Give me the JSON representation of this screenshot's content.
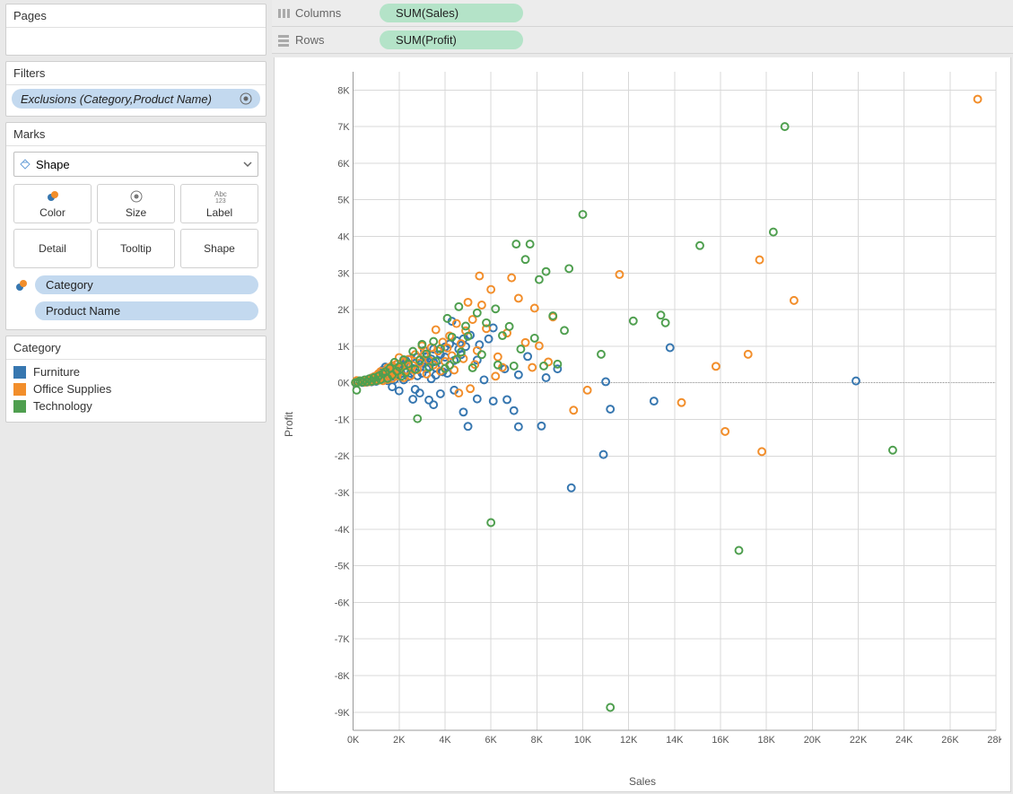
{
  "panels": {
    "pages_title": "Pages",
    "filters_title": "Filters",
    "marks_title": "Marks",
    "legend_title": "Category"
  },
  "filters": {
    "pill_label": "Exclusions (Category,Product Name)"
  },
  "marks": {
    "type_label": "Shape",
    "buttons": {
      "color": "Color",
      "size": "Size",
      "label": "Label",
      "detail": "Detail",
      "tooltip": "Tooltip",
      "shape": "Shape"
    },
    "shelves": [
      "Category",
      "Product Name"
    ]
  },
  "legend": {
    "items": [
      {
        "label": "Furniture",
        "color": "#3777b0"
      },
      {
        "label": "Office Supplies",
        "color": "#f28e2b"
      },
      {
        "label": "Technology",
        "color": "#4f9f4f"
      }
    ]
  },
  "shelves": {
    "columns_label": "Columns",
    "rows_label": "Rows",
    "columns_field": "SUM(Sales)",
    "rows_field": "SUM(Profit)"
  },
  "chart_data": {
    "type": "scatter",
    "xlabel": "Sales",
    "ylabel": "Profit",
    "xlim": [
      0,
      28000
    ],
    "ylim": [
      -9500,
      8500
    ],
    "x_ticks": [
      0,
      2000,
      4000,
      6000,
      8000,
      10000,
      12000,
      14000,
      16000,
      18000,
      20000,
      22000,
      24000,
      26000,
      28000
    ],
    "x_tick_labels": [
      "0K",
      "2K",
      "4K",
      "6K",
      "8K",
      "10K",
      "12K",
      "14K",
      "16K",
      "18K",
      "20K",
      "22K",
      "24K",
      "26K",
      "28K"
    ],
    "y_ticks": [
      -9000,
      -8000,
      -7000,
      -6000,
      -5000,
      -4000,
      -3000,
      -2000,
      -1000,
      0,
      1000,
      2000,
      3000,
      4000,
      5000,
      6000,
      7000,
      8000
    ],
    "y_tick_labels": [
      "-9K",
      "-8K",
      "-7K",
      "-6K",
      "-5K",
      "-4K",
      "-3K",
      "-2K",
      "-1K",
      "0K",
      "1K",
      "2K",
      "3K",
      "4K",
      "5K",
      "6K",
      "7K",
      "8K"
    ],
    "series": [
      {
        "name": "Furniture",
        "color": "#3777b0",
        "points": [
          [
            21900,
            50
          ],
          [
            13800,
            960
          ],
          [
            13100,
            -500
          ],
          [
            11200,
            -720
          ],
          [
            11000,
            30
          ],
          [
            10900,
            -1960
          ],
          [
            9500,
            -2870
          ],
          [
            8900,
            380
          ],
          [
            8400,
            140
          ],
          [
            8200,
            -1180
          ],
          [
            7600,
            720
          ],
          [
            7200,
            -1200
          ],
          [
            7200,
            220
          ],
          [
            7000,
            -760
          ],
          [
            6700,
            -460
          ],
          [
            6600,
            380
          ],
          [
            6100,
            -500
          ],
          [
            6100,
            1500
          ],
          [
            5900,
            1200
          ],
          [
            5700,
            80
          ],
          [
            5500,
            1040
          ],
          [
            5400,
            -440
          ],
          [
            5400,
            620
          ],
          [
            5100,
            1300
          ],
          [
            5000,
            -1190
          ],
          [
            4900,
            990
          ],
          [
            4800,
            1200
          ],
          [
            4800,
            -800
          ],
          [
            4700,
            770
          ],
          [
            4600,
            920
          ],
          [
            4500,
            1150
          ],
          [
            4400,
            -200
          ],
          [
            4400,
            610
          ],
          [
            4300,
            1680
          ],
          [
            4200,
            1060
          ],
          [
            4100,
            260
          ],
          [
            4000,
            700
          ],
          [
            4000,
            980
          ],
          [
            3900,
            300
          ],
          [
            3800,
            -300
          ],
          [
            3800,
            770
          ],
          [
            3700,
            610
          ],
          [
            3600,
            410
          ],
          [
            3600,
            210
          ],
          [
            3500,
            -600
          ],
          [
            3500,
            920
          ],
          [
            3500,
            570
          ],
          [
            3400,
            650
          ],
          [
            3400,
            110
          ],
          [
            3300,
            -470
          ],
          [
            3300,
            440
          ],
          [
            3200,
            720
          ],
          [
            3200,
            380
          ],
          [
            3100,
            880
          ],
          [
            3100,
            620
          ],
          [
            3000,
            260
          ],
          [
            3000,
            540
          ],
          [
            2900,
            -280
          ],
          [
            2900,
            420
          ],
          [
            2800,
            700
          ],
          [
            2800,
            190
          ],
          [
            2700,
            -180
          ],
          [
            2700,
            530
          ],
          [
            2600,
            390
          ],
          [
            2600,
            -450
          ],
          [
            2500,
            650
          ],
          [
            2500,
            260
          ],
          [
            2400,
            490
          ],
          [
            2400,
            170
          ],
          [
            2300,
            600
          ],
          [
            2300,
            310
          ],
          [
            2200,
            80
          ],
          [
            2200,
            460
          ],
          [
            2100,
            530
          ],
          [
            2100,
            250
          ],
          [
            2000,
            -220
          ],
          [
            2000,
            380
          ],
          [
            1900,
            500
          ],
          [
            1900,
            230
          ],
          [
            1800,
            340
          ],
          [
            1800,
            90
          ],
          [
            1700,
            450
          ],
          [
            1700,
            180
          ],
          [
            1700,
            -110
          ],
          [
            1600,
            380
          ],
          [
            1600,
            160
          ],
          [
            1500,
            60
          ],
          [
            1500,
            310
          ],
          [
            1400,
            240
          ],
          [
            1400,
            430
          ],
          [
            1300,
            170
          ],
          [
            1300,
            350
          ],
          [
            1200,
            100
          ],
          [
            1200,
            280
          ],
          [
            1100,
            70
          ],
          [
            1100,
            230
          ],
          [
            1000,
            40
          ],
          [
            1000,
            190
          ],
          [
            900,
            160
          ],
          [
            900,
            60
          ],
          [
            800,
            130
          ],
          [
            800,
            25
          ],
          [
            700,
            100
          ],
          [
            700,
            40
          ],
          [
            600,
            80
          ],
          [
            600,
            20
          ],
          [
            500,
            60
          ],
          [
            500,
            15
          ],
          [
            400,
            45
          ],
          [
            400,
            10
          ],
          [
            300,
            25
          ],
          [
            200,
            15
          ],
          [
            200,
            55
          ],
          [
            100,
            8
          ]
        ]
      },
      {
        "name": "Office Supplies",
        "color": "#f28e2b",
        "points": [
          [
            27200,
            7750
          ],
          [
            19200,
            2250
          ],
          [
            17200,
            780
          ],
          [
            17700,
            3360
          ],
          [
            17800,
            -1880
          ],
          [
            16200,
            -1330
          ],
          [
            14300,
            -540
          ],
          [
            15800,
            450
          ],
          [
            11600,
            2960
          ],
          [
            10200,
            -200
          ],
          [
            9600,
            -750
          ],
          [
            8700,
            1800
          ],
          [
            8500,
            570
          ],
          [
            8100,
            1010
          ],
          [
            7900,
            2040
          ],
          [
            7800,
            420
          ],
          [
            7500,
            1100
          ],
          [
            7200,
            2310
          ],
          [
            6900,
            2870
          ],
          [
            6700,
            1360
          ],
          [
            6500,
            420
          ],
          [
            6300,
            710
          ],
          [
            6200,
            180
          ],
          [
            6000,
            2550
          ],
          [
            5800,
            1480
          ],
          [
            5600,
            2125
          ],
          [
            5500,
            2920
          ],
          [
            5400,
            880
          ],
          [
            5300,
            500
          ],
          [
            5200,
            1730
          ],
          [
            5100,
            -160
          ],
          [
            5000,
            2200
          ],
          [
            4900,
            1420
          ],
          [
            4800,
            660
          ],
          [
            4700,
            1070
          ],
          [
            4600,
            -280
          ],
          [
            4500,
            1620
          ],
          [
            4400,
            350
          ],
          [
            4300,
            740
          ],
          [
            4200,
            1280
          ],
          [
            4100,
            950
          ],
          [
            4000,
            580
          ],
          [
            3900,
            1110
          ],
          [
            3800,
            320
          ],
          [
            3700,
            870
          ],
          [
            3600,
            1450
          ],
          [
            3500,
            490
          ],
          [
            3400,
            960
          ],
          [
            3300,
            620
          ],
          [
            3200,
            240
          ],
          [
            3100,
            780
          ],
          [
            3000,
            1010
          ],
          [
            2900,
            540
          ],
          [
            2800,
            360
          ],
          [
            2700,
            770
          ],
          [
            2600,
            470
          ],
          [
            2500,
            190
          ],
          [
            2400,
            640
          ],
          [
            2300,
            350
          ],
          [
            2200,
            570
          ],
          [
            2200,
            140
          ],
          [
            2100,
            440
          ],
          [
            2000,
            290
          ],
          [
            2000,
            690
          ],
          [
            1900,
            510
          ],
          [
            1900,
            180
          ],
          [
            1800,
            390
          ],
          [
            1800,
            260
          ],
          [
            1700,
            470
          ],
          [
            1700,
            120
          ],
          [
            1600,
            340
          ],
          [
            1600,
            230
          ],
          [
            1500,
            410
          ],
          [
            1500,
            90
          ],
          [
            1400,
            280
          ],
          [
            1400,
            180
          ],
          [
            1300,
            60
          ],
          [
            1300,
            230
          ],
          [
            1200,
            310
          ],
          [
            1200,
            140
          ],
          [
            1100,
            250
          ],
          [
            1100,
            70
          ],
          [
            1000,
            190
          ],
          [
            1000,
            100
          ],
          [
            900,
            160
          ],
          [
            900,
            60
          ],
          [
            800,
            130
          ],
          [
            800,
            40
          ],
          [
            700,
            100
          ],
          [
            700,
            30
          ],
          [
            600,
            75
          ],
          [
            600,
            25
          ],
          [
            500,
            55
          ],
          [
            500,
            15
          ],
          [
            400,
            40
          ],
          [
            300,
            25
          ],
          [
            200,
            15
          ],
          [
            150,
            60
          ],
          [
            100,
            8
          ]
        ]
      },
      {
        "name": "Technology",
        "color": "#4f9f4f",
        "points": [
          [
            18800,
            7000
          ],
          [
            18300,
            4120
          ],
          [
            15100,
            3750
          ],
          [
            16800,
            -4580
          ],
          [
            23500,
            -1840
          ],
          [
            13600,
            1640
          ],
          [
            13400,
            1850
          ],
          [
            12200,
            1690
          ],
          [
            11200,
            -8870
          ],
          [
            10800,
            780
          ],
          [
            10000,
            4600
          ],
          [
            9400,
            3120
          ],
          [
            9200,
            1430
          ],
          [
            8900,
            510
          ],
          [
            8700,
            1830
          ],
          [
            8400,
            3040
          ],
          [
            8300,
            460
          ],
          [
            8100,
            2820
          ],
          [
            7900,
            1220
          ],
          [
            7700,
            3790
          ],
          [
            7500,
            3370
          ],
          [
            7300,
            920
          ],
          [
            7100,
            3790
          ],
          [
            7000,
            460
          ],
          [
            6800,
            1540
          ],
          [
            6500,
            1290
          ],
          [
            6300,
            490
          ],
          [
            6200,
            2020
          ],
          [
            6000,
            -3820
          ],
          [
            5800,
            1640
          ],
          [
            5600,
            770
          ],
          [
            5400,
            1910
          ],
          [
            5200,
            410
          ],
          [
            5000,
            1270
          ],
          [
            4900,
            1550
          ],
          [
            4700,
            840
          ],
          [
            4600,
            2080
          ],
          [
            4500,
            640
          ],
          [
            4300,
            1250
          ],
          [
            4200,
            480
          ],
          [
            4100,
            1760
          ],
          [
            4000,
            390
          ],
          [
            3800,
            930
          ],
          [
            3600,
            590
          ],
          [
            3500,
            1130
          ],
          [
            3300,
            420
          ],
          [
            3200,
            790
          ],
          [
            3000,
            1050
          ],
          [
            2800,
            -980
          ],
          [
            2900,
            620
          ],
          [
            2700,
            370
          ],
          [
            2600,
            860
          ],
          [
            2400,
            520
          ],
          [
            2300,
            280
          ],
          [
            2200,
            630
          ],
          [
            2100,
            180
          ],
          [
            2000,
            440
          ],
          [
            1900,
            320
          ],
          [
            1800,
            560
          ],
          [
            1700,
            210
          ],
          [
            1600,
            400
          ],
          [
            1500,
            120
          ],
          [
            1400,
            300
          ],
          [
            1300,
            250
          ],
          [
            1200,
            90
          ],
          [
            1100,
            180
          ],
          [
            1000,
            60
          ],
          [
            900,
            140
          ],
          [
            800,
            40
          ],
          [
            700,
            110
          ],
          [
            600,
            30
          ],
          [
            500,
            80
          ],
          [
            400,
            20
          ],
          [
            300,
            55
          ],
          [
            200,
            15
          ],
          [
            150,
            -200
          ],
          [
            100,
            5
          ]
        ]
      }
    ]
  }
}
